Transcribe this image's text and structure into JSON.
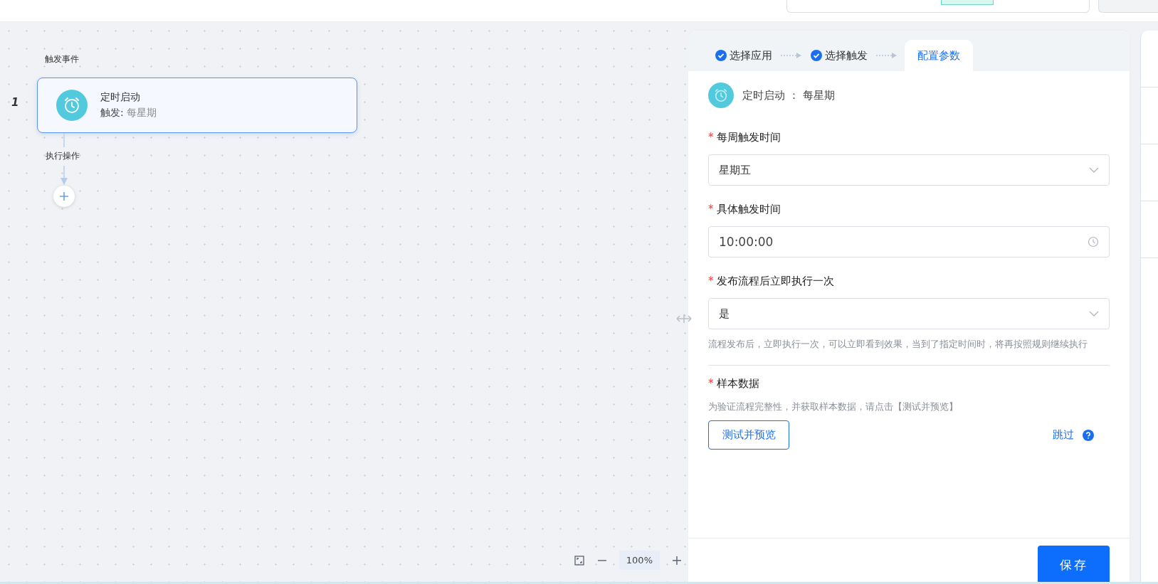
{
  "canvas": {
    "trigger_label": "触发事件",
    "step_number": "1",
    "node": {
      "title": "定时启动",
      "trigger_prefix": "触发:",
      "trigger_value": "每星期",
      "selected": true
    },
    "action_label": "执行操作",
    "zoom_text": "100%"
  },
  "steps": [
    {
      "label": "选择应用",
      "done": true,
      "selected": false
    },
    {
      "label": "选择触发",
      "done": true,
      "selected": false
    },
    {
      "label": "配置参数",
      "done": false,
      "selected": true
    }
  ],
  "summary": "定时启动 ： 每星期",
  "fields": [
    {
      "kind": "select",
      "required_mark": "*",
      "label": "每周触发时间",
      "value": "星期五"
    },
    {
      "kind": "time",
      "required_mark": "*",
      "label": "具体触发时间",
      "value": "10:00:00"
    },
    {
      "kind": "select",
      "required_mark": "*",
      "label": "发布流程后立即执行一次",
      "value": "是",
      "help": "流程发布后，立即执行一次，可以立即看到效果，当到了指定时间时，将再按照规则继续执行"
    }
  ],
  "sample": {
    "required_mark": "*",
    "label": "样本数据",
    "help": "为验证流程完整性，并获取样本数据，请点击【测试并预览】",
    "test_button": "测试并预览",
    "skip_link": "跳过"
  },
  "save_button": "保存"
}
